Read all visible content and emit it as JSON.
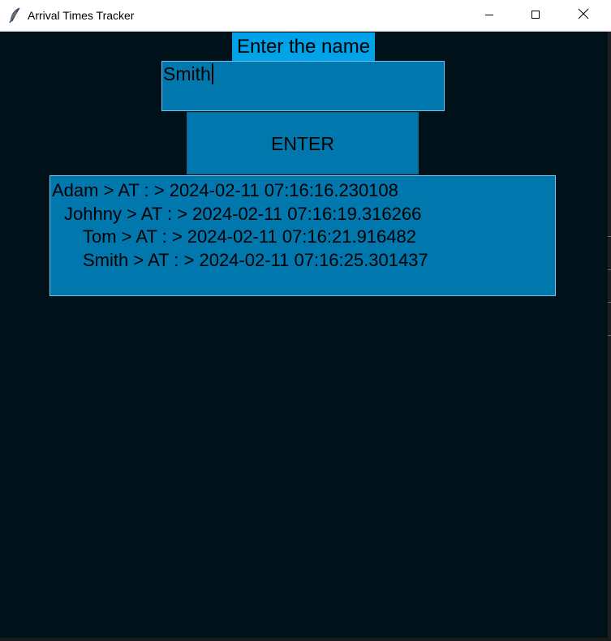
{
  "window": {
    "title": "Arrival Times Tracker",
    "app_icon": "feather-icon",
    "controls": [
      "minimize-icon",
      "maximize-icon",
      "close-icon"
    ]
  },
  "form": {
    "prompt_label": "Enter the name",
    "name_input_value": "Smith",
    "enter_button_label": "ENTER"
  },
  "arrivals": [
    "Adam > AT : > 2024-02-11 07:16:16.230108",
    "Johhny > AT : > 2024-02-11 07:16:19.316266",
    "Tom > AT : > 2024-02-11 07:16:21.916482",
    "Smith > AT : > 2024-02-11 07:16:25.301437"
  ],
  "colors": {
    "background": "#00111a",
    "label_background": "#00a2e8",
    "widget_background": "#0077ad",
    "widget_border": "#6ec3f0"
  }
}
